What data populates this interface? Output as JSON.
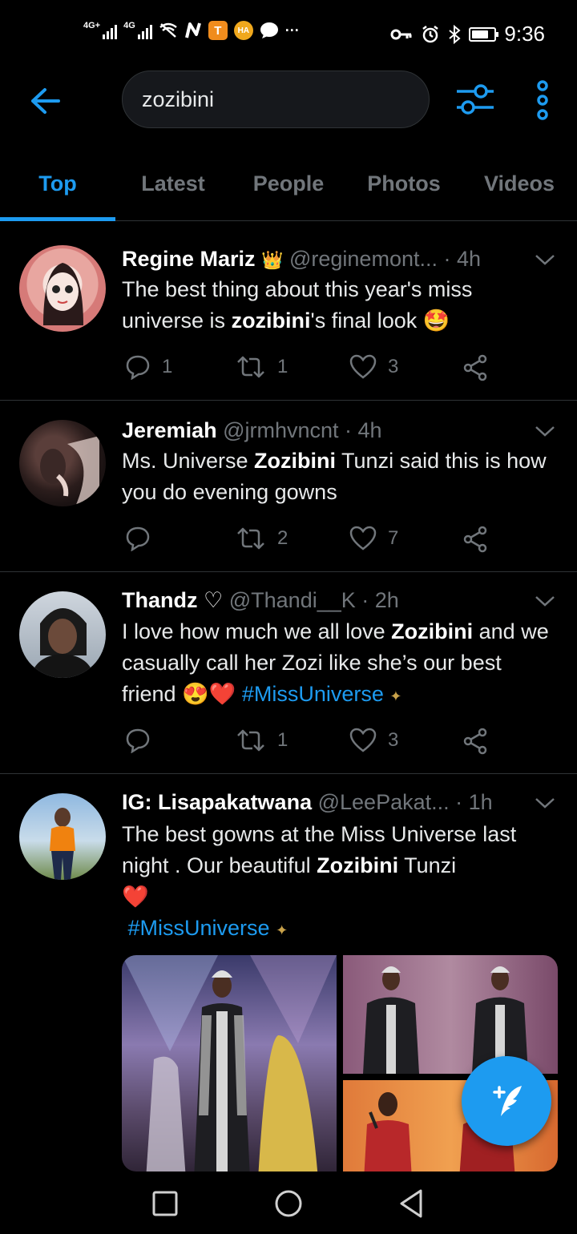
{
  "status_bar": {
    "net1": "4G+",
    "net2": "4G",
    "app_t": "T",
    "app_ha": "HA",
    "more": "···",
    "time": "9:36",
    "battery_level": 0.75
  },
  "header": {
    "search_value": "zozibini"
  },
  "tabs": [
    {
      "label": "Top",
      "active": true
    },
    {
      "label": "Latest",
      "active": false
    },
    {
      "label": "People",
      "active": false
    },
    {
      "label": "Photos",
      "active": false
    },
    {
      "label": "Videos",
      "active": false
    }
  ],
  "tweets": [
    {
      "name": "Regine Mariz",
      "badge": "👑",
      "handle": "@reginemont...",
      "time": "· 4h",
      "body": {
        "t1": "The best thing about this year's miss universe is ",
        "bold1": "zozibini",
        "t2": "'s final look ",
        "emoji": "🤩"
      },
      "replies": "1",
      "retweets": "1",
      "likes": "3"
    },
    {
      "name": "Jeremiah",
      "handle": "@jrmhvncnt · 4h",
      "body": {
        "t1": "Ms. Universe ",
        "bold1": "Zozibini",
        "t2": " Tunzi said this is how you do evening gowns"
      },
      "replies": "",
      "retweets": "2",
      "likes": "7"
    },
    {
      "name": "Thandz",
      "badge": "♡",
      "handle": "@Thandi__K · 2h",
      "body": {
        "t1": "I love how much we all love ",
        "bold1": "Zozibini",
        "t2": " and we casually call her Zozi like she’s our best friend ",
        "emoji": "😍❤️",
        "hashtag": "#MissUniverse",
        "sparkle": "✦"
      },
      "replies": "",
      "retweets": "1",
      "likes": "3"
    },
    {
      "name": "IG: Lisapakatwana",
      "handle": "@LeePakat...",
      "time": "· 1h",
      "body": {
        "t1": "The best gowns at the Miss Universe last night . Our beautiful ",
        "bold1": "Zozibini",
        "t2": " Tunzi",
        "emoji": "❤️",
        "hashtag": "#MissUniverse",
        "sparkle": "✦"
      }
    }
  ],
  "colors": {
    "accent": "#1d9bf0",
    "background": "#000000",
    "muted": "#71767b",
    "divider": "#2f3336"
  },
  "icons": {
    "back": "arrow-left-icon",
    "filter": "sliders-icon",
    "more": "more-vertical-icon",
    "reply": "reply-icon",
    "retweet": "retweet-icon",
    "like": "heart-icon",
    "share": "share-icon",
    "compose": "compose-tweet-icon",
    "nav_recent": "square-icon",
    "nav_home": "circle-icon",
    "nav_back": "triangle-back-icon"
  }
}
